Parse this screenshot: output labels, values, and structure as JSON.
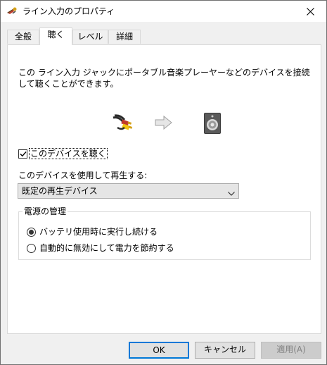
{
  "window": {
    "title": "ライン入力のプロパティ",
    "icon": "speaker-icon"
  },
  "tabs": [
    {
      "label": "全般",
      "active": false
    },
    {
      "label": "聴く",
      "active": true
    },
    {
      "label": "レベル",
      "active": false
    },
    {
      "label": "詳細",
      "active": false
    }
  ],
  "listen": {
    "description": "この ライン入力 ジャックにポータブル音楽プレーヤーなどのデバイスを接続して聴くことができます。",
    "checkbox_label": "このデバイスを聴く",
    "checkbox_checked": true,
    "playback_label": "このデバイスを使用して再生する:",
    "playback_selected": "既定の再生デバイス"
  },
  "power": {
    "title": "電源の管理",
    "options": [
      {
        "label": "バッテリ使用時に実行し続ける",
        "selected": true
      },
      {
        "label": "自動的に無効にして電力を節約する",
        "selected": false
      }
    ]
  },
  "buttons": {
    "ok": "OK",
    "cancel": "キャンセル",
    "apply": "適用(A)",
    "apply_enabled": false
  },
  "colors": {
    "accent": "#0078d7",
    "dialog_bg": "#f0f0f0",
    "panel_bg": "#ffffff"
  }
}
